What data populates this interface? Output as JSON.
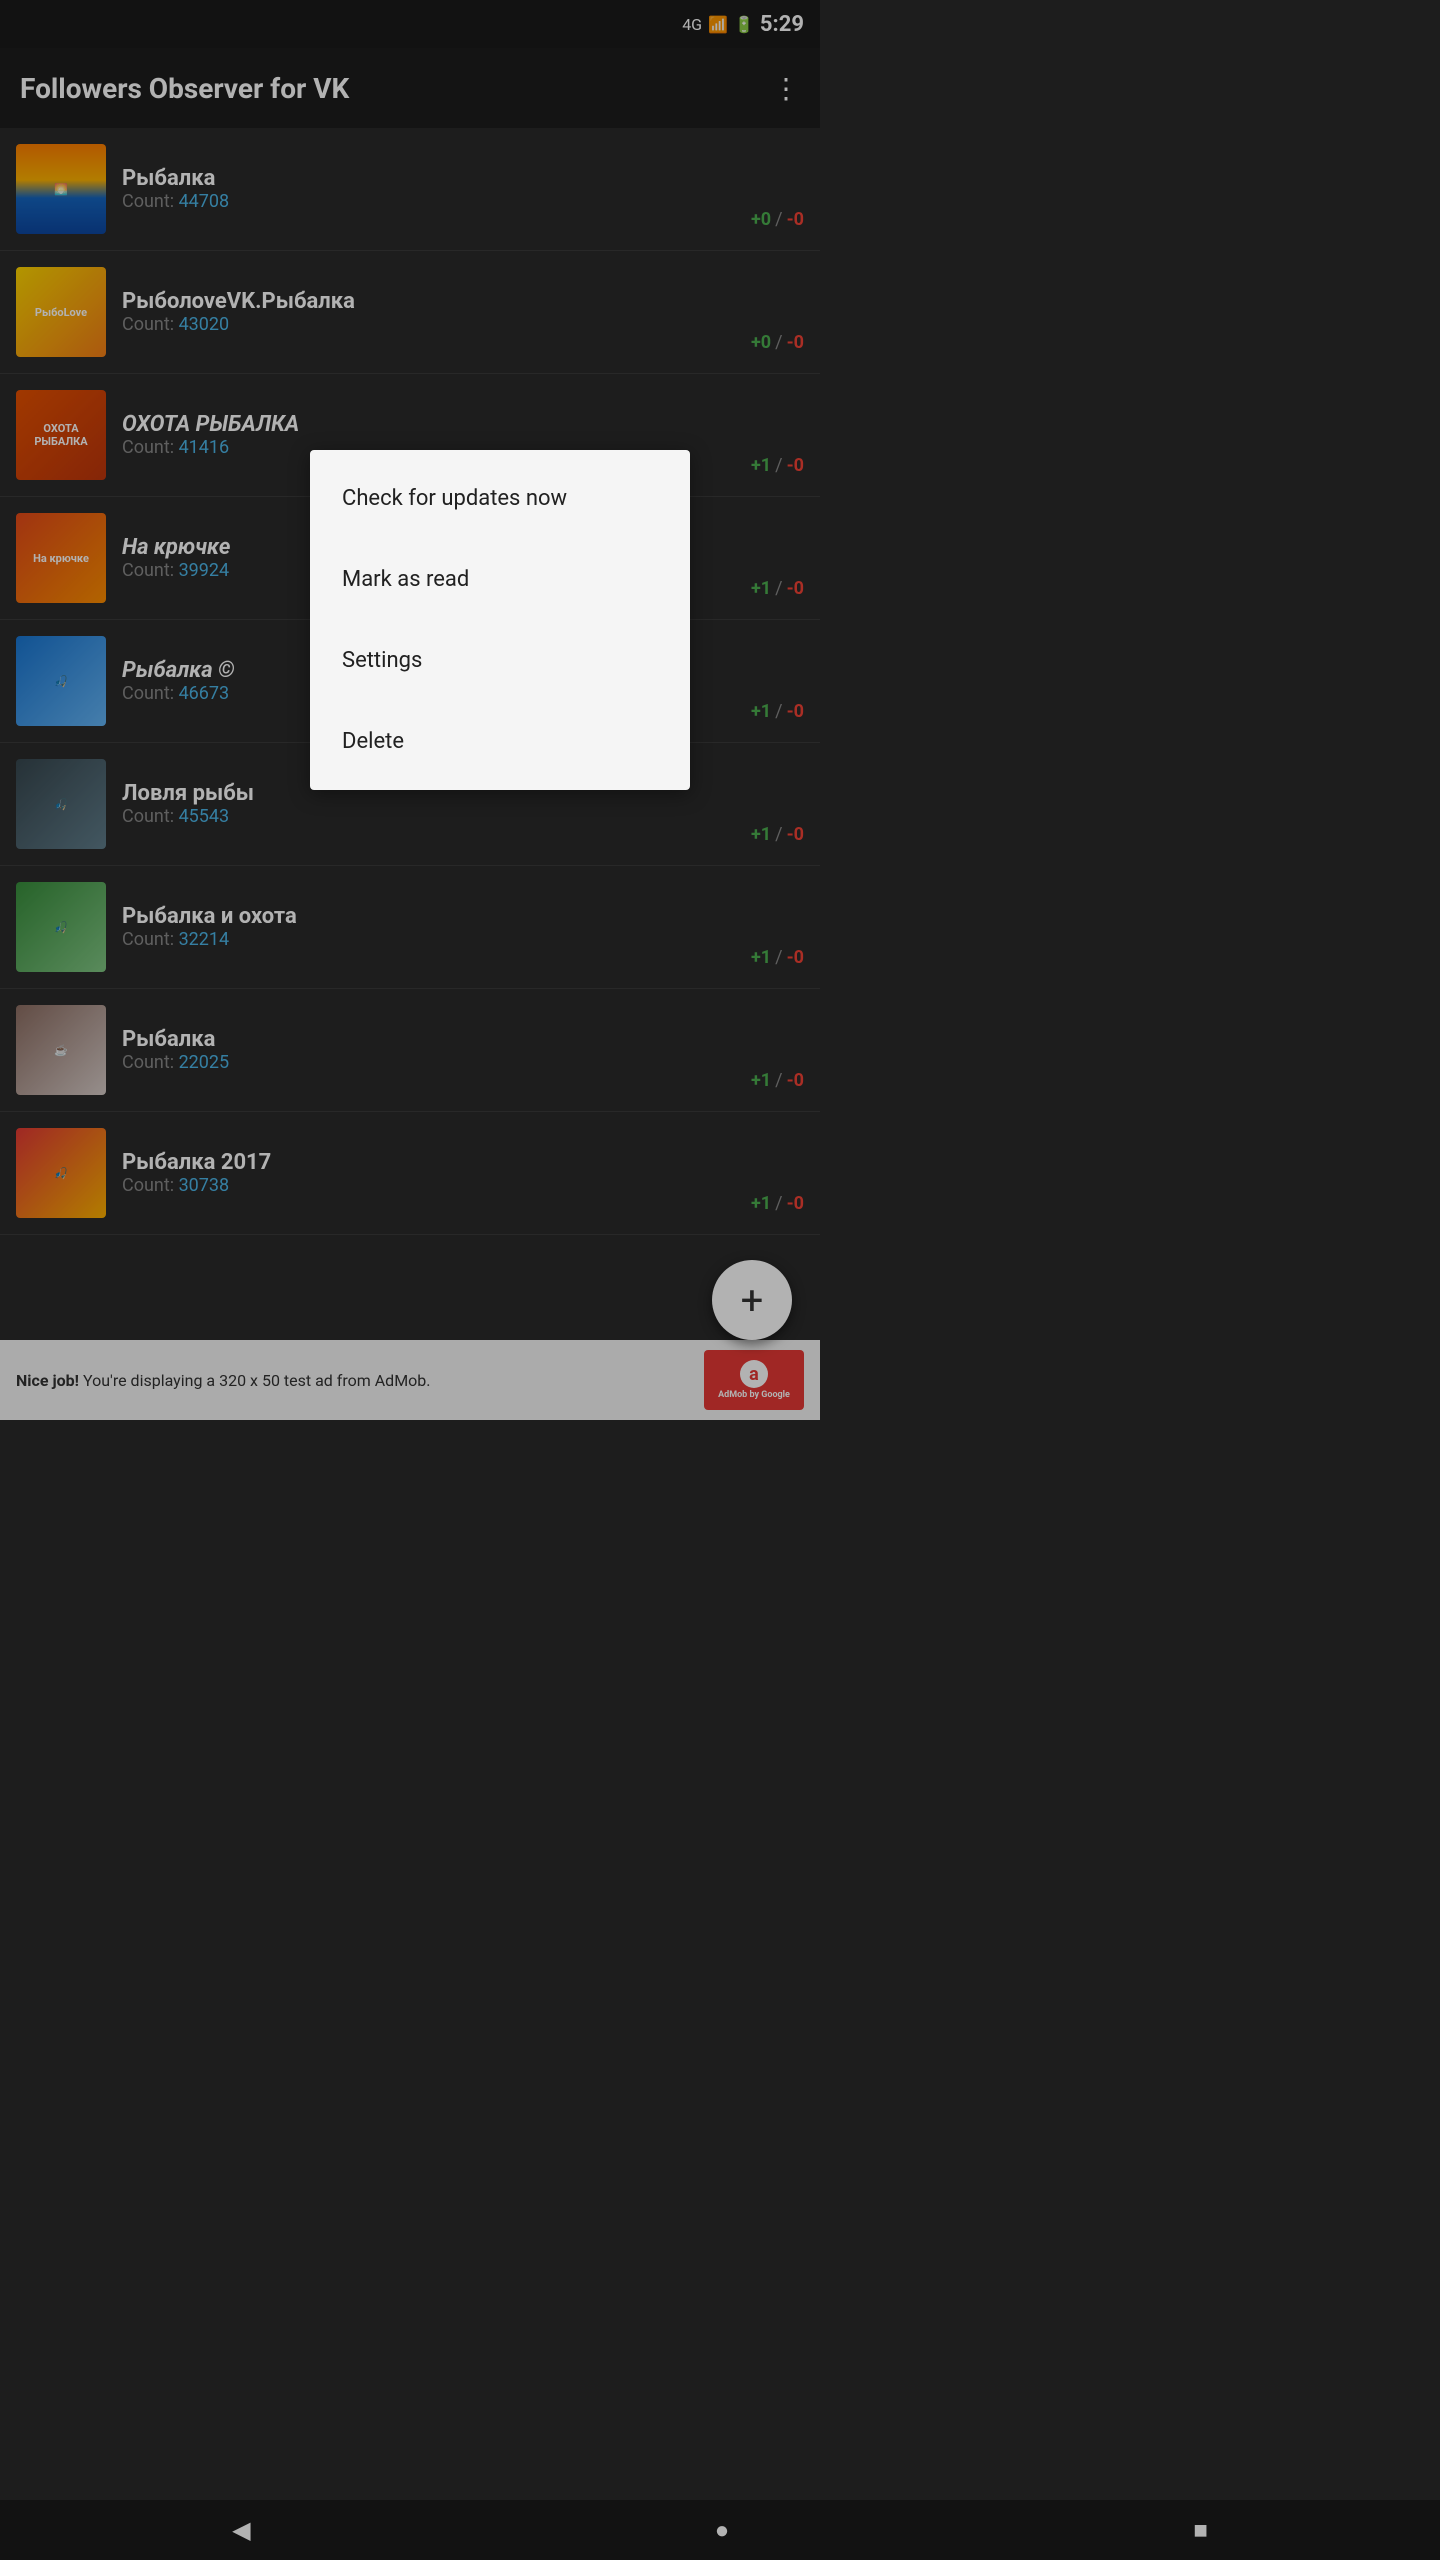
{
  "statusBar": {
    "time": "5:29",
    "network": "4G",
    "battery": "⚡"
  },
  "appBar": {
    "title": "Followers Observer for VK",
    "moreIcon": "⋮"
  },
  "listItems": [
    {
      "id": 1,
      "name": "Рыбалка",
      "count": "44708",
      "statPlus": "+0",
      "statMinus": "-0",
      "avatarClass": "avatar-sunrise",
      "avatarLabel": "🌅"
    },
    {
      "id": 2,
      "name": "РыболoveVK.Рыбалка",
      "count": "43020",
      "statPlus": "+0",
      "statMinus": "-0",
      "avatarClass": "avatar-rybolove",
      "avatarLabel": "РыбоLove"
    },
    {
      "id": 3,
      "name": "ОХОТА РЫБАЛКА",
      "count": "41416",
      "statPlus": "+1",
      "statMinus": "-0",
      "avatarClass": "avatar-ohota",
      "avatarLabel": "ОХОТА РЫБАЛКА",
      "italic": true
    },
    {
      "id": 4,
      "name": "На крючке",
      "count": "39924",
      "statPlus": "+1",
      "statMinus": "-0",
      "avatarClass": "avatar-na-kryuchke",
      "avatarLabel": "На крючке",
      "italic": true
    },
    {
      "id": 5,
      "name": "Рыбалка ©",
      "count": "46673",
      "statPlus": "+1",
      "statMinus": "-0",
      "avatarClass": "avatar-rybalka5",
      "avatarLabel": "🎣",
      "italic": true
    },
    {
      "id": 6,
      "name": "Ловля рыбы",
      "count": "45543",
      "statPlus": "+1",
      "statMinus": "-0",
      "avatarClass": "avatar-lovlya",
      "avatarLabel": "🎣"
    },
    {
      "id": 7,
      "name": "Рыбалка и охота",
      "count": "32214",
      "statPlus": "+1",
      "statMinus": "-0",
      "avatarClass": "avatar-ohota-i",
      "avatarLabel": "🎣"
    },
    {
      "id": 8,
      "name": "Рыбалка",
      "count": "22025",
      "statPlus": "+1",
      "statMinus": "-0",
      "avatarClass": "avatar-rybalka-coffee",
      "avatarLabel": "☕"
    },
    {
      "id": 9,
      "name": "Рыбалка 2017",
      "count": "30738",
      "statPlus": "+1",
      "statMinus": "-0",
      "avatarClass": "avatar-rybalka2017",
      "avatarLabel": "🎣"
    }
  ],
  "contextMenu": {
    "items": [
      {
        "id": "check-updates",
        "label": "Check for updates now"
      },
      {
        "id": "mark-read",
        "label": "Mark as read"
      },
      {
        "id": "settings",
        "label": "Settings"
      },
      {
        "id": "delete",
        "label": "Delete"
      }
    ]
  },
  "fab": {
    "icon": "+"
  },
  "adBanner": {
    "text": "Nice job! You're displaying a 320 x 50 test ad from AdMob.",
    "logoText": "AdMob by Google"
  },
  "navBar": {
    "back": "◀",
    "home": "●",
    "square": "■"
  },
  "labels": {
    "count": "Count: "
  }
}
